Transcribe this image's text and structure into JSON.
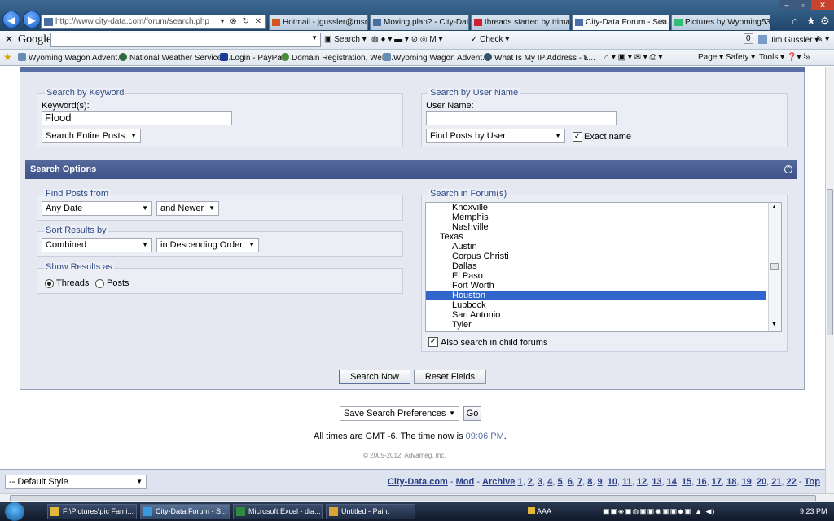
{
  "browser": {
    "address": "http://www.city-data.com/forum/search.php",
    "tabs": [
      {
        "label": "Hotmail - jgussler@msn..."
      },
      {
        "label": "Moving plan? - City-Data ..."
      },
      {
        "label": "threads started by trimac ..."
      },
      {
        "label": "City-Data Forum - Sea..."
      },
      {
        "label": "Pictures by Wyoming53 - ..."
      }
    ],
    "toolbar": {
      "google": "Google",
      "search": "Search",
      "check": "Check",
      "user": "Jim Gussler",
      "count": "0"
    },
    "favorites": [
      "Wyoming Wagon Advent...",
      "National Weather Service ...",
      "Login - PayPal",
      "Domain Registration, Web...",
      "Wyoming Wagon Advent...",
      "What Is My IP Address - L..."
    ],
    "commands": {
      "page": "Page",
      "safety": "Safety",
      "tools": "Tools"
    }
  },
  "search_keyword": {
    "legend": "Search by Keyword",
    "label": "Keyword(s):",
    "value": "Flood",
    "scope": "Search Entire Posts"
  },
  "search_user": {
    "legend": "Search by User Name",
    "label": "User Name:",
    "value": "",
    "mode": "Find Posts by User",
    "exact_label": "Exact name"
  },
  "options": {
    "title": "Search Options",
    "find_from": {
      "legend": "Find Posts from",
      "date": "Any Date",
      "direction": "and Newer"
    },
    "sort": {
      "legend": "Sort Results by",
      "field": "Combined",
      "order": "in Descending Order"
    },
    "show": {
      "legend": "Show Results as",
      "threads": "Threads",
      "posts": "Posts"
    },
    "forums": {
      "legend": "Search in Forum(s)",
      "items": [
        {
          "label": "Knoxville",
          "level": 2
        },
        {
          "label": "Memphis",
          "level": 2
        },
        {
          "label": "Nashville",
          "level": 2
        },
        {
          "label": "Texas",
          "level": 1
        },
        {
          "label": "Austin",
          "level": 2
        },
        {
          "label": "Corpus Christi",
          "level": 2
        },
        {
          "label": "Dallas",
          "level": 2
        },
        {
          "label": "El Paso",
          "level": 2
        },
        {
          "label": "Fort Worth",
          "level": 2
        },
        {
          "label": "Houston",
          "level": 2,
          "selected": true
        },
        {
          "label": "Lubbock",
          "level": 2
        },
        {
          "label": "San Antonio",
          "level": 2
        },
        {
          "label": "Tyler",
          "level": 2
        }
      ],
      "child_label": "Also search in child forums"
    }
  },
  "buttons": {
    "search": "Search Now",
    "reset": "Reset Fields",
    "go": "Go"
  },
  "prefs": "Save Search Preferences",
  "time_note": "All times are GMT -6. The time now is",
  "time_value": "09:06 PM",
  "time_end": ".",
  "copyright": "© 2005-2012, Advameg, Inc.",
  "style_select": "-- Default Style",
  "footer_links": {
    "site": "City-Data.com",
    "mod": "Mod",
    "archive": "Archive",
    "pages": [
      "1",
      "2",
      "3",
      "4",
      "5",
      "6",
      "7",
      "8",
      "9",
      "10",
      "11",
      "12",
      "13",
      "14",
      "15",
      "16",
      "17",
      "18",
      "19",
      "20",
      "21",
      "22"
    ],
    "top": "Top"
  },
  "taskbar": {
    "tasks": [
      "F:\\Pictures\\pic Fami...",
      "City-Data Forum - S...",
      "Microsoft Excel - dia...",
      "Untitled - Paint"
    ],
    "aaa": "AAA",
    "clock": "9:23 PM"
  }
}
